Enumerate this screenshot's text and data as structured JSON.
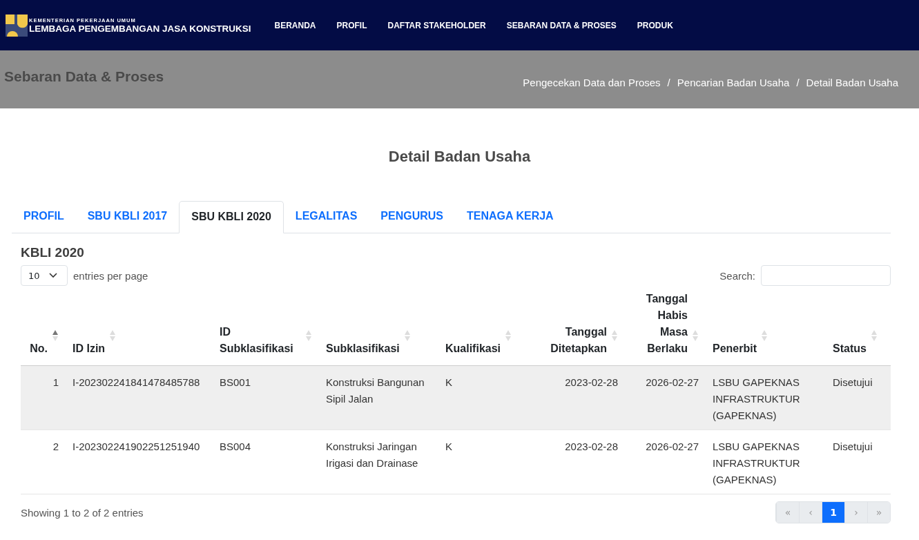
{
  "logo": {
    "ministry": "KEMENTERIAN PEKERJAAN UMUM",
    "agency": "LEMBAGA PENGEMBANGAN JASA KONSTRUKSI"
  },
  "nav": [
    "BERANDA",
    "PROFIL",
    "DAFTAR STAKEHOLDER",
    "SEBARAN DATA & PROSES",
    "PRODUK"
  ],
  "banner": {
    "title": "Sebaran Data & Proses",
    "breadcrumb": [
      {
        "label": "Pengecekan Data dan Proses"
      },
      {
        "separator": "/",
        "label": "Pencarian Badan Usaha"
      },
      {
        "separator": "/",
        "label": "Detail Badan Usaha"
      }
    ]
  },
  "page_title": "Detail Badan Usaha",
  "tabs": [
    {
      "label": "PROFIL",
      "selected": false
    },
    {
      "label": "SBU KBLI 2017",
      "selected": false
    },
    {
      "label": "SBU KBLI 2020",
      "selected": true
    },
    {
      "label": "LEGALITAS",
      "selected": false
    },
    {
      "label": "PENGURUS",
      "selected": false
    },
    {
      "label": "TENAGA KERJA",
      "selected": false
    }
  ],
  "section_title": "KBLI 2020",
  "per_page": {
    "value": "10",
    "label": "entries per page"
  },
  "search": {
    "label": "Search:"
  },
  "table": {
    "columns": [
      {
        "label": "No.",
        "sorted": true
      },
      {
        "label": "ID Izin",
        "sorted": false
      },
      {
        "label": "ID Subklasifikasi",
        "sorted": false
      },
      {
        "label": "Subklasifikasi",
        "sorted": false
      },
      {
        "label": "Kualifikasi",
        "sorted": false
      },
      {
        "label": "Tanggal Ditetapkan",
        "sorted": false
      },
      {
        "label": "Tanggal Habis Masa Berlaku",
        "sorted": false
      },
      {
        "label": "Penerbit",
        "sorted": false
      },
      {
        "label": "Status",
        "sorted": false
      }
    ],
    "rows": [
      [
        "1",
        "I-202302241841478485788",
        "BS001",
        "Konstruksi Bangunan Sipil Jalan",
        "K",
        "2023-02-28",
        "2026-02-27",
        "LSBU GAPEKNAS INFRASTRUKTUR (GAPEKNAS)",
        "Disetujui"
      ],
      [
        "2",
        "I-202302241902251251940",
        "BS004",
        "Konstruksi Jaringan Irigasi dan Drainase",
        "K",
        "2023-02-28",
        "2026-02-27",
        "LSBU GAPEKNAS INFRASTRUKTUR (GAPEKNAS)",
        "Disetujui"
      ]
    ]
  },
  "info": "Showing 1 to 2 of 2 entries",
  "pager": [
    {
      "label": "«",
      "disabled": true,
      "selected": false
    },
    {
      "label": "‹",
      "disabled": true,
      "selected": false
    },
    {
      "label": "1",
      "disabled": false,
      "selected": true
    },
    {
      "label": "›",
      "disabled": true,
      "selected": false
    },
    {
      "label": "»",
      "disabled": true,
      "selected": false
    }
  ]
}
